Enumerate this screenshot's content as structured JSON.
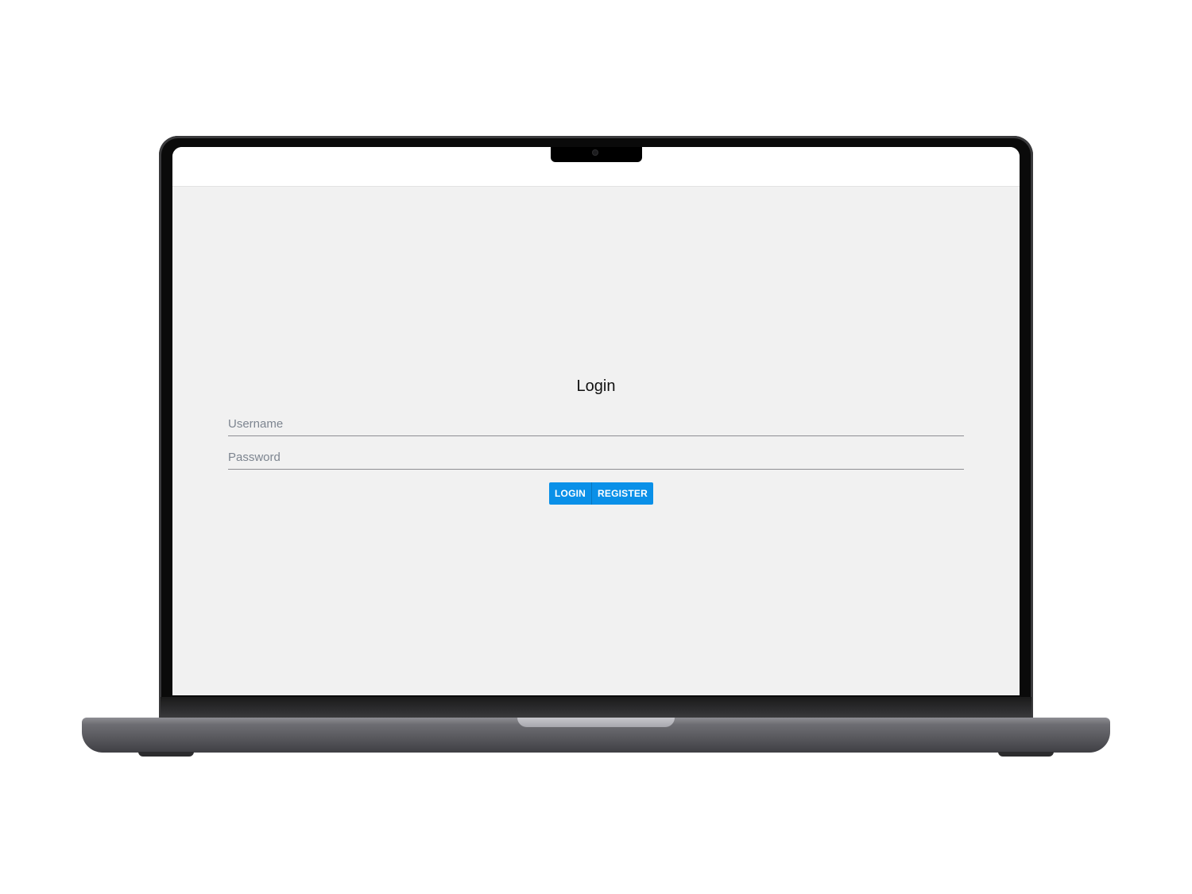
{
  "login_form": {
    "title": "Login",
    "username_placeholder": "Username",
    "password_placeholder": "Password",
    "login_label": "LOGIN",
    "register_label": "REGISTER"
  },
  "colors": {
    "accent": "#0a90e8",
    "screen_background": "#f1f1f1",
    "device_frame": "#0a0a0a"
  }
}
